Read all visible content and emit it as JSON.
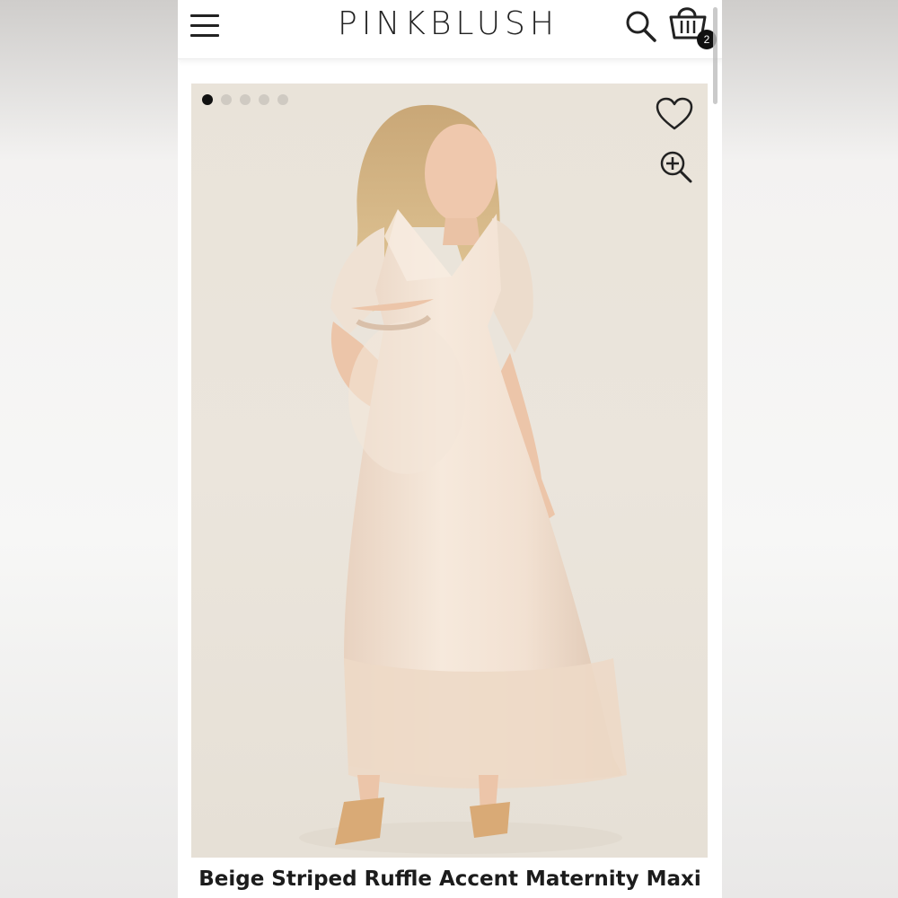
{
  "header": {
    "brand": "PINKBLUSH",
    "menu_icon": "hamburger-menu-icon",
    "search_icon": "search-icon",
    "cart_icon": "shopping-bag-icon",
    "cart_count": "2"
  },
  "gallery": {
    "image_count": 5,
    "active_index": 0,
    "wishlist_icon": "heart-icon",
    "zoom_icon": "zoom-in-icon",
    "image_alt": "Model wearing beige satin striped ruffle maxi dress"
  },
  "product": {
    "title": "Beige Striped Ruffle Accent Maternity Maxi"
  },
  "colors": {
    "brand_text": "#222222",
    "image_background": "#e9e3d9",
    "dress": "#f1dfcf",
    "dot_active": "#111111",
    "dot_inactive": "#cfcac2"
  }
}
